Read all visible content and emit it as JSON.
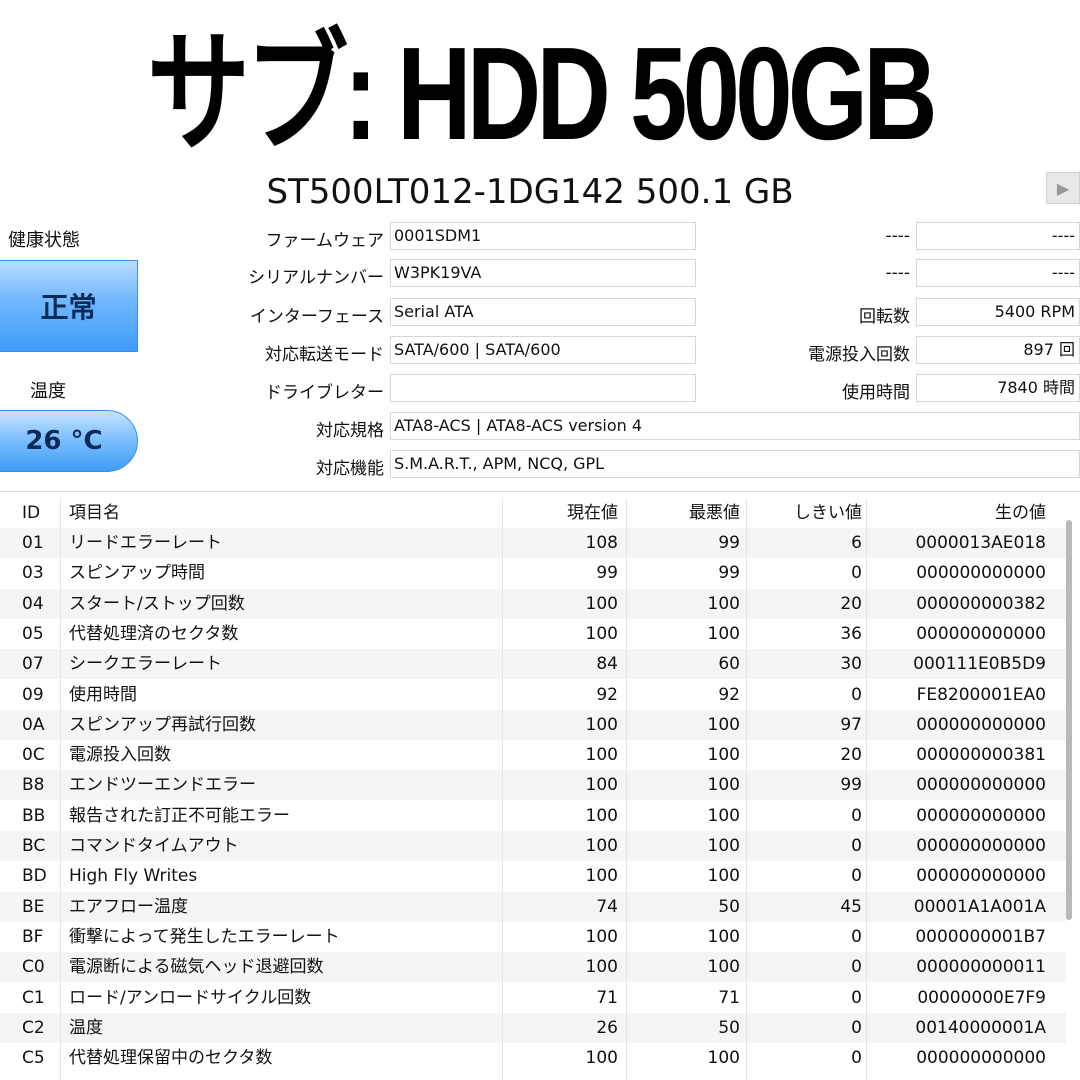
{
  "banner": "サブ: HDD 500GB",
  "model": "ST500LT012-1DG142 500.1 GB",
  "health": {
    "label": "健康状態",
    "status": "正常",
    "color": "#4aa3f7"
  },
  "temperature": {
    "label": "温度",
    "value": "26 °C"
  },
  "info_left": [
    {
      "label": "ファームウェア",
      "value": "0001SDM1"
    },
    {
      "label": "シリアルナンバー",
      "value": "W3PK19VA"
    },
    {
      "label": "インターフェース",
      "value": "Serial ATA"
    },
    {
      "label": "対応転送モード",
      "value": "SATA/600 | SATA/600"
    },
    {
      "label": "ドライブレター",
      "value": ""
    }
  ],
  "info_right": [
    {
      "label": "----",
      "value": "----"
    },
    {
      "label": "----",
      "value": "----"
    },
    {
      "label": "回転数",
      "value": "5400 RPM"
    },
    {
      "label": "電源投入回数",
      "value": "897 回"
    },
    {
      "label": "使用時間",
      "value": "7840 時間"
    }
  ],
  "standard": {
    "label": "対応規格",
    "value": "ATA8-ACS | ATA8-ACS version 4"
  },
  "features": {
    "label": "対応機能",
    "value": "S.M.A.R.T., APM, NCQ, GPL"
  },
  "table": {
    "headers": {
      "id": "ID",
      "name": "項目名",
      "current": "現在値",
      "worst": "最悪値",
      "threshold": "しきい値",
      "raw": "生の値"
    },
    "rows": [
      {
        "id": "01",
        "name": "リードエラーレート",
        "current": "108",
        "worst": "99",
        "threshold": "6",
        "raw": "0000013AE018"
      },
      {
        "id": "03",
        "name": "スピンアップ時間",
        "current": "99",
        "worst": "99",
        "threshold": "0",
        "raw": "000000000000"
      },
      {
        "id": "04",
        "name": "スタート/ストップ回数",
        "current": "100",
        "worst": "100",
        "threshold": "20",
        "raw": "000000000382"
      },
      {
        "id": "05",
        "name": "代替処理済のセクタ数",
        "current": "100",
        "worst": "100",
        "threshold": "36",
        "raw": "000000000000"
      },
      {
        "id": "07",
        "name": "シークエラーレート",
        "current": "84",
        "worst": "60",
        "threshold": "30",
        "raw": "000111E0B5D9"
      },
      {
        "id": "09",
        "name": "使用時間",
        "current": "92",
        "worst": "92",
        "threshold": "0",
        "raw": "FE8200001EA0"
      },
      {
        "id": "0A",
        "name": "スピンアップ再試行回数",
        "current": "100",
        "worst": "100",
        "threshold": "97",
        "raw": "000000000000"
      },
      {
        "id": "0C",
        "name": "電源投入回数",
        "current": "100",
        "worst": "100",
        "threshold": "20",
        "raw": "000000000381"
      },
      {
        "id": "B8",
        "name": "エンドツーエンドエラー",
        "current": "100",
        "worst": "100",
        "threshold": "99",
        "raw": "000000000000"
      },
      {
        "id": "BB",
        "name": "報告された訂正不可能エラー",
        "current": "100",
        "worst": "100",
        "threshold": "0",
        "raw": "000000000000"
      },
      {
        "id": "BC",
        "name": "コマンドタイムアウト",
        "current": "100",
        "worst": "100",
        "threshold": "0",
        "raw": "000000000000"
      },
      {
        "id": "BD",
        "name": "High Fly Writes",
        "current": "100",
        "worst": "100",
        "threshold": "0",
        "raw": "000000000000"
      },
      {
        "id": "BE",
        "name": "エアフロー温度",
        "current": "74",
        "worst": "50",
        "threshold": "45",
        "raw": "00001A1A001A"
      },
      {
        "id": "BF",
        "name": "衝撃によって発生したエラーレート",
        "current": "100",
        "worst": "100",
        "threshold": "0",
        "raw": "0000000001B7"
      },
      {
        "id": "C0",
        "name": "電源断による磁気ヘッド退避回数",
        "current": "100",
        "worst": "100",
        "threshold": "0",
        "raw": "000000000011"
      },
      {
        "id": "C1",
        "name": "ロード/アンロードサイクル回数",
        "current": "71",
        "worst": "71",
        "threshold": "0",
        "raw": "00000000E7F9"
      },
      {
        "id": "C2",
        "name": "温度",
        "current": "26",
        "worst": "50",
        "threshold": "0",
        "raw": "00140000001A"
      },
      {
        "id": "C5",
        "name": "代替処理保留中のセクタ数",
        "current": "100",
        "worst": "100",
        "threshold": "0",
        "raw": "000000000000"
      }
    ]
  }
}
